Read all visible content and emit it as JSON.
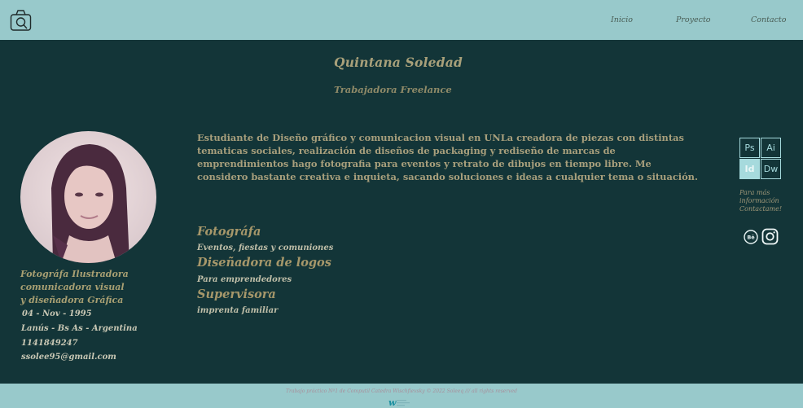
{
  "nav": {
    "home": "Inicio",
    "project": "Proyecto",
    "contact": "Contacto"
  },
  "profile": {
    "name": "Quintana Soledad",
    "role": "Trabajadora Freelance",
    "tagline": [
      "Fotográfa Ilustradora",
      "comunicadora visual",
      "y diseñadora Gráfica"
    ],
    "birthdate": "04 - Nov - 1995",
    "location": "Lanús - Bs As - Argentina",
    "phone": "1141849247",
    "email": "ssolee95@gmail.com"
  },
  "bio": "Estudiante de Diseño gráfico y comunicacion visual en UNLa creadora de piezas con distintas tematicas sociales, realización de diseños de packaging y rediseño de marcas de emprendimientos hago fotografia para eventos y retrato de dibujos en tiempo libre. Me considero bastante creativa e inquieta, sacando soluciones e ideas a cualquier tema o situación.",
  "jobs": [
    {
      "title": "Fotográfa",
      "subtitle": "Eventos, fiestas y comuniones"
    },
    {
      "title": "Diseñadora de logos",
      "subtitle": "Para emprendedores"
    },
    {
      "title": "Supervisora",
      "subtitle": "imprenta familiar"
    }
  ],
  "skills": [
    "Ps",
    "Ai",
    "Id",
    "Dw"
  ],
  "contact_prompt": [
    "Para más",
    "información",
    "Contactame!"
  ],
  "social": {
    "behance": "Bē"
  },
  "footer": {
    "copyright": "Trabajo práctico Nº1 de Computil Catedra Wischfievsky © 2022 Soleeq /// all rights reserved",
    "logo_letter": "w"
  },
  "colors": {
    "background": "#133538",
    "bar": "#98c9cb",
    "accent": "#a89f72",
    "skill": "#a6dadd"
  }
}
